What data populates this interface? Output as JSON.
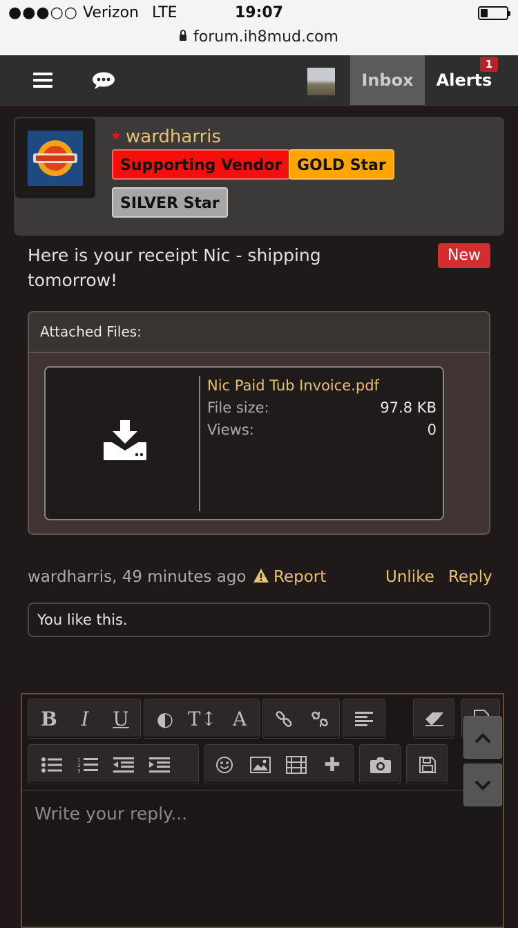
{
  "status_bar": {
    "signal": "●●●○○",
    "carrier": "Verizon",
    "network": "LTE",
    "time": "19:07",
    "url": "forum.ih8mud.com"
  },
  "nav": {
    "menu_icon": "hamburger-menu-icon",
    "chat_icon": "chat-bubble-icon",
    "inbox_label": "Inbox",
    "alerts_label": "Alerts",
    "alerts_count": "1"
  },
  "post": {
    "username": "wardharris",
    "badges": [
      {
        "label": "Supporting Vendor",
        "color": "#f60d0d"
      },
      {
        "label": "GOLD Star",
        "color": "#ffa500"
      },
      {
        "label": "SILVER Star",
        "color": "#a6a6a6"
      }
    ],
    "message": "Here is your receipt Nic - shipping tomorrow!",
    "new_label": "New",
    "attachments": {
      "header": "Attached Files:",
      "file": {
        "name": "Nic Paid Tub Invoice.pdf",
        "size_label": "File size:",
        "size": "97.8 KB",
        "views_label": "Views:",
        "views": "0"
      }
    },
    "meta": "wardharris, 49 minutes ago",
    "report": "Report",
    "unlike": "Unlike",
    "reply": "Reply",
    "likes_text": "You like this."
  },
  "editor": {
    "placeholder": "Write your reply...",
    "toolbar_icons": [
      "bold-icon",
      "italic-icon",
      "underline-icon",
      "color-icon",
      "font-size-icon",
      "font-family-icon",
      "link-icon",
      "unlink-icon",
      "align-icon",
      "eraser-icon",
      "source-icon",
      "bullet-list-icon",
      "numbered-list-icon",
      "outdent-icon",
      "indent-icon",
      "smilie-icon",
      "image-icon",
      "media-icon",
      "insert-more-icon",
      "camera-icon",
      "save-draft-icon"
    ]
  },
  "colors": {
    "accent": "#e7c16f",
    "background": "#1f1a19",
    "new_badge": "#d42d2d",
    "alert_badge": "#b3232b"
  }
}
